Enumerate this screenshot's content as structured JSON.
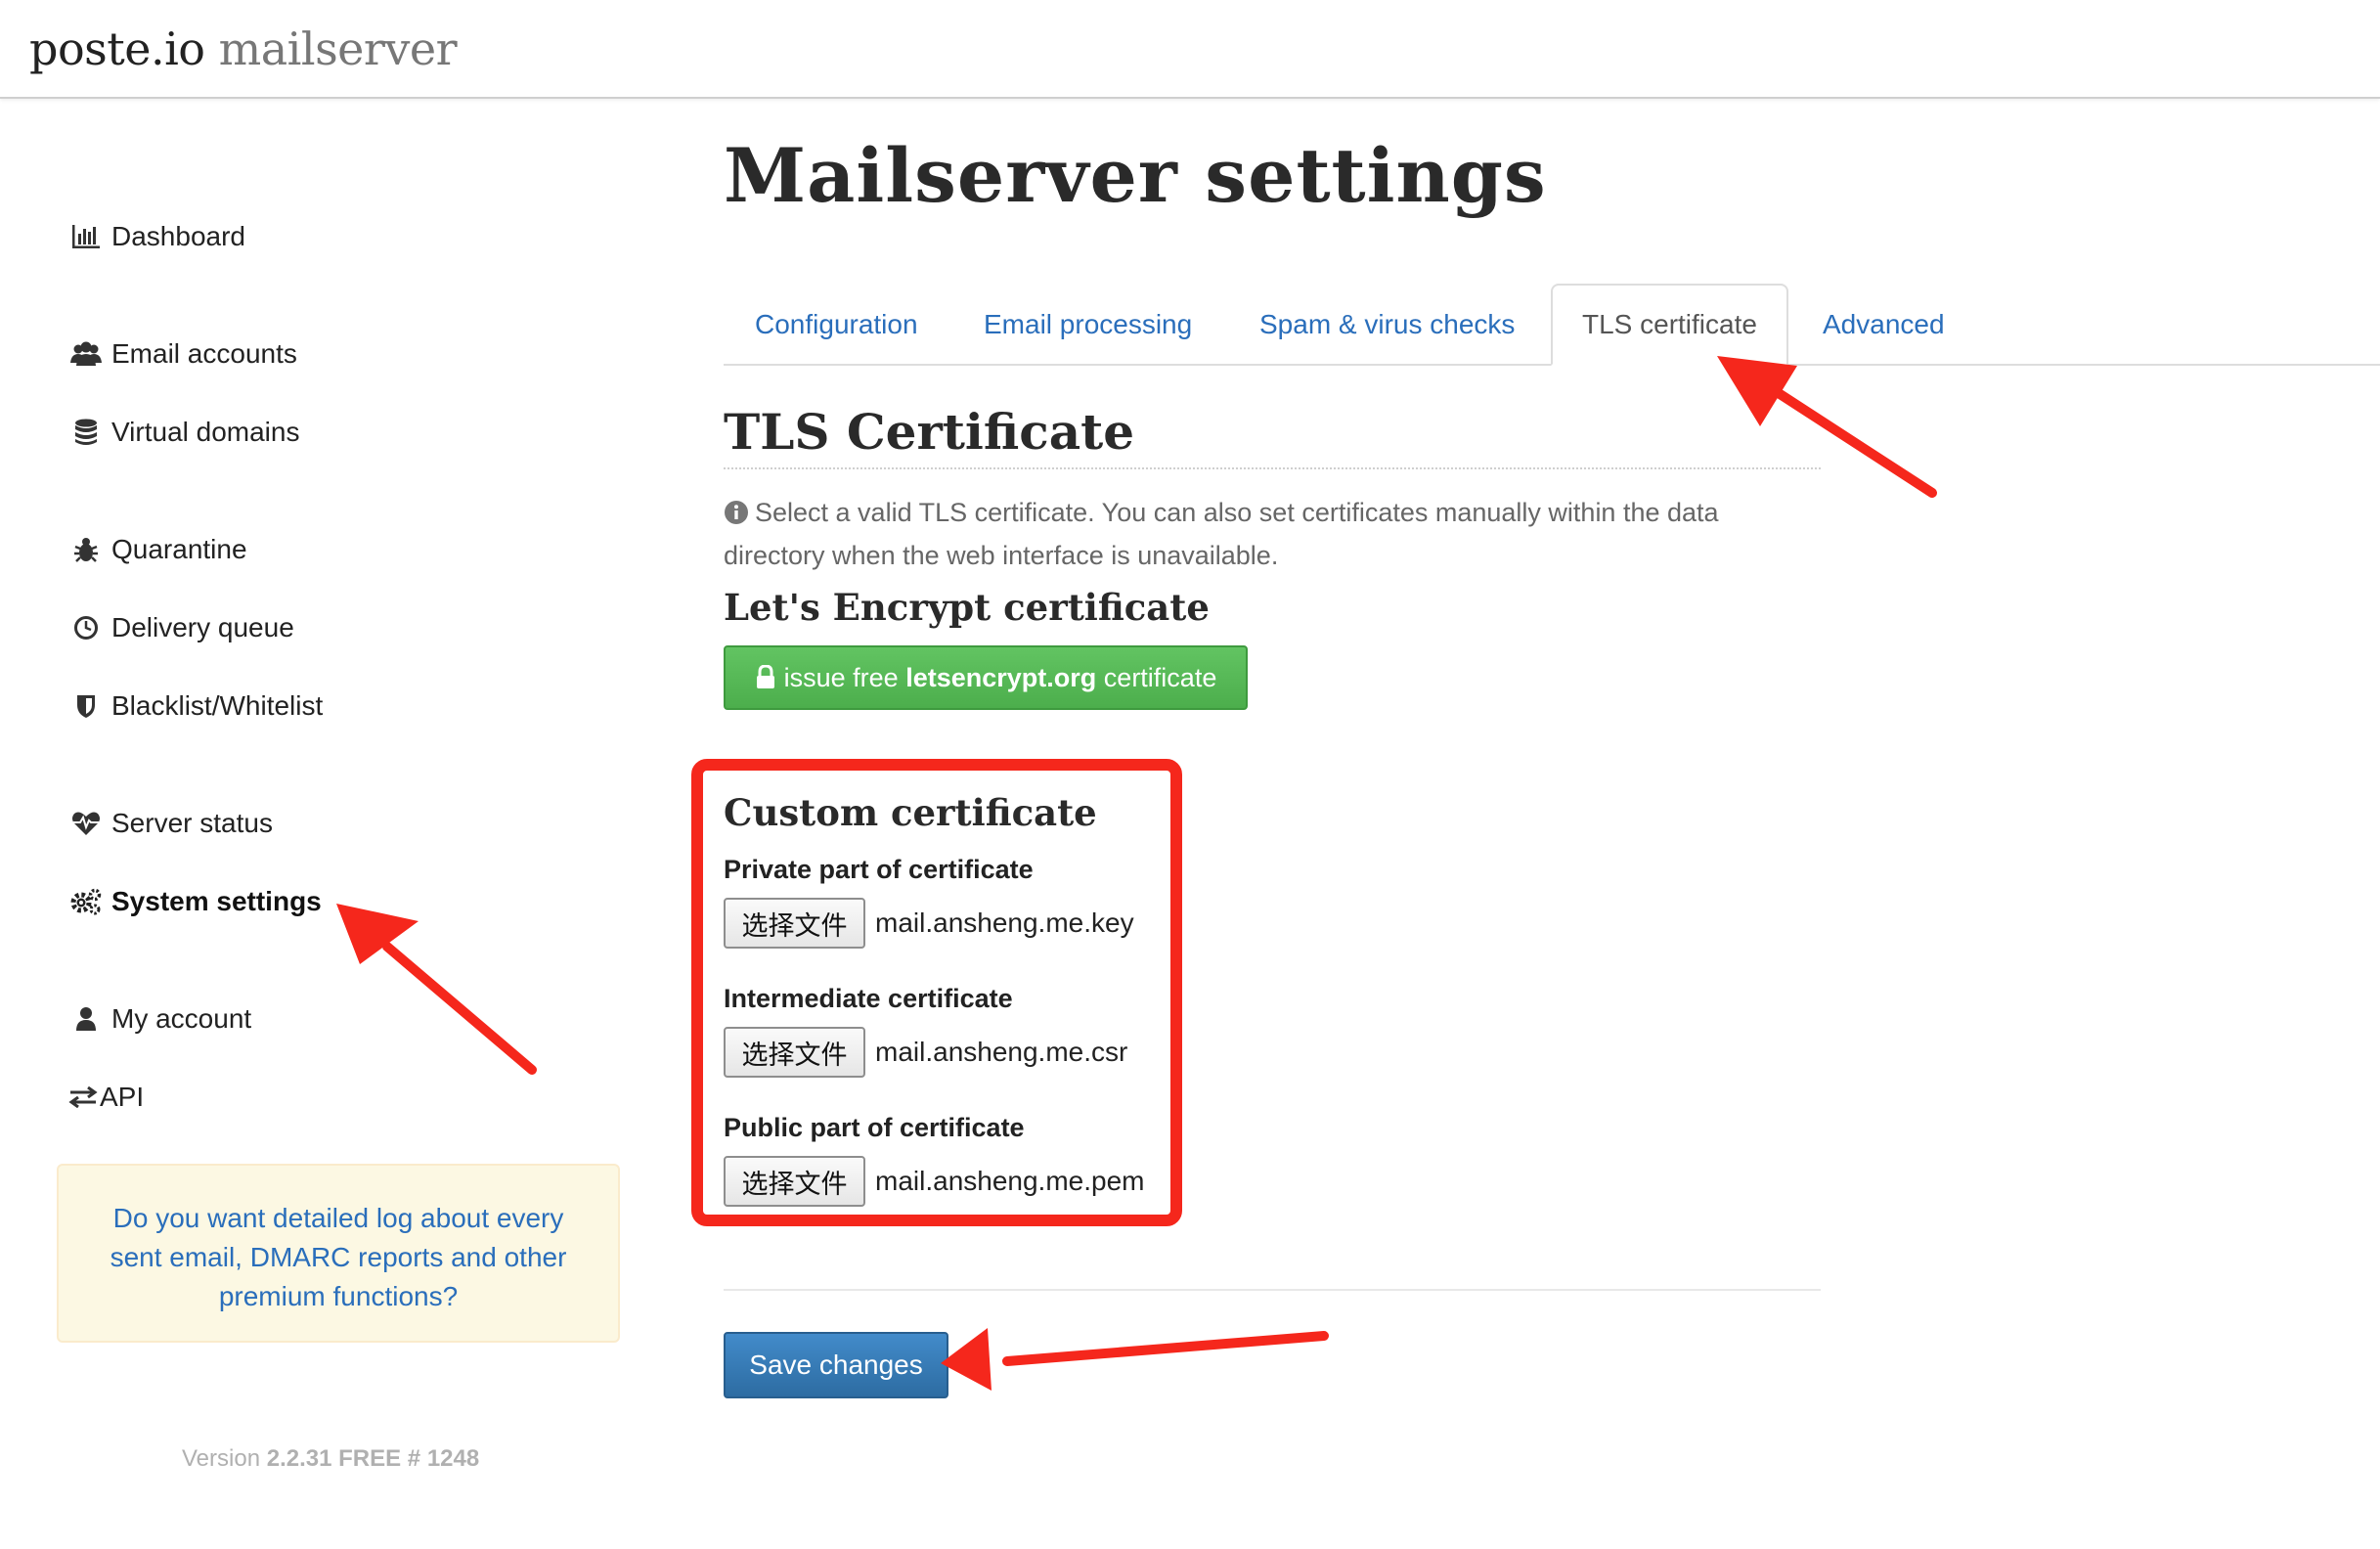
{
  "brand": {
    "name": "poste.io",
    "product": "mailserver"
  },
  "sidebar": {
    "items": [
      {
        "label": "Dashboard",
        "icon": "bar-chart-icon"
      },
      {
        "label": "Email accounts",
        "icon": "users-icon"
      },
      {
        "label": "Virtual domains",
        "icon": "database-icon"
      },
      {
        "label": "Quarantine",
        "icon": "bug-icon"
      },
      {
        "label": "Delivery queue",
        "icon": "clock-icon"
      },
      {
        "label": "Blacklist/Whitelist",
        "icon": "shield-icon"
      },
      {
        "label": "Server status",
        "icon": "heartbeat-icon"
      },
      {
        "label": "System settings",
        "icon": "gears-icon",
        "active": true
      },
      {
        "label": "My account",
        "icon": "user-icon"
      },
      {
        "label": "API",
        "icon": "exchange-icon"
      }
    ],
    "promo": "Do you want detailed log about every sent email, DMARC reports and other premium functions?",
    "version_prefix": "Version",
    "version_value": "2.2.31 FREE # 1248"
  },
  "main": {
    "title": "Mailserver settings",
    "tabs": [
      {
        "label": "Configuration"
      },
      {
        "label": "Email processing"
      },
      {
        "label": "Spam & virus checks"
      },
      {
        "label": "TLS certificate",
        "active": true
      },
      {
        "label": "Advanced"
      }
    ],
    "section_title": "TLS Certificate",
    "help_text": "Select a valid TLS certificate. You can also set certificates manually within the data directory when the web interface is unavailable.",
    "letsencrypt": {
      "heading": "Let's Encrypt certificate",
      "button_prefix": "issue free",
      "button_bold": "letsencrypt.org",
      "button_suffix": "certificate"
    },
    "custom": {
      "heading": "Custom certificate",
      "fields": [
        {
          "label": "Private part of certificate",
          "button": "选择文件",
          "file": "mail.ansheng.me.key"
        },
        {
          "label": "Intermediate certificate",
          "button": "选择文件",
          "file": "mail.ansheng.me.csr"
        },
        {
          "label": "Public part of certificate",
          "button": "选择文件",
          "file": "mail.ansheng.me.pem"
        }
      ]
    },
    "save_label": "Save changes"
  },
  "colors": {
    "link": "#2a6ebb",
    "success": "#5cb85c",
    "primary": "#337ab7",
    "annotation": "#f5271c",
    "promo_bg": "#fcf8e3"
  }
}
